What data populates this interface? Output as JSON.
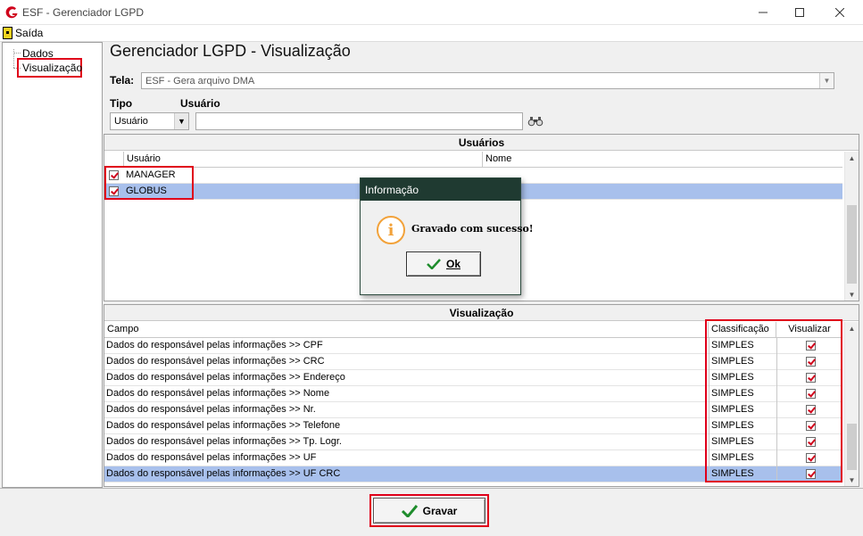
{
  "window": {
    "title": "ESF - Gerenciador LGPD",
    "controls": [
      "minimize",
      "maximize",
      "close"
    ]
  },
  "menu": {
    "exit_label": "Saída"
  },
  "tree": {
    "items": [
      {
        "label": "Dados"
      },
      {
        "label": "Visualização",
        "selected": true
      }
    ]
  },
  "main": {
    "title": "Gerenciador LGPD - Visualização",
    "screen_label": "Tela:",
    "screen_value": "ESF - Gera arquivo DMA",
    "type_label": "Tipo",
    "type_value": "Usuário",
    "user_label": "Usuário",
    "user_value": ""
  },
  "users_panel": {
    "title": "Usuários",
    "columns": [
      "Usuário",
      "Nome"
    ],
    "rows": [
      {
        "checked": true,
        "user": "MANAGER",
        "name": "",
        "selected": false
      },
      {
        "checked": true,
        "user": "GLOBUS",
        "name": "",
        "selected": true
      }
    ]
  },
  "view_panel": {
    "title": "Visualização",
    "columns": [
      "Campo",
      "Classificação",
      "Visualizar"
    ],
    "rows": [
      {
        "field": "Dados do responsável pelas informações >> CPF",
        "class": "SIMPLES",
        "visible": true
      },
      {
        "field": "Dados do responsável pelas informações >> CRC",
        "class": "SIMPLES",
        "visible": true
      },
      {
        "field": "Dados do responsável pelas informações >> Endereço",
        "class": "SIMPLES",
        "visible": true
      },
      {
        "field": "Dados do responsável pelas informações >> Nome",
        "class": "SIMPLES",
        "visible": true
      },
      {
        "field": "Dados do responsável pelas informações >> Nr.",
        "class": "SIMPLES",
        "visible": true
      },
      {
        "field": "Dados do responsável pelas informações >> Telefone",
        "class": "SIMPLES",
        "visible": true
      },
      {
        "field": "Dados do responsável pelas informações >> Tp. Logr.",
        "class": "SIMPLES",
        "visible": true
      },
      {
        "field": "Dados do responsável pelas informações >> UF",
        "class": "SIMPLES",
        "visible": true
      },
      {
        "field": "Dados do responsável pelas informações >> UF CRC",
        "class": "SIMPLES",
        "visible": true,
        "selected": true
      }
    ]
  },
  "dialog": {
    "title": "Informação",
    "message": "Gravado com sucesso!",
    "ok_label": "Ok"
  },
  "footer": {
    "save_label": "Gravar"
  },
  "colors": {
    "highlight_red": "#e0001a",
    "selection": "#a8c0ec",
    "dialog_title_bg": "#1f3a31",
    "info_orange": "#f2a23a",
    "check_green": "#1e8c2c"
  }
}
